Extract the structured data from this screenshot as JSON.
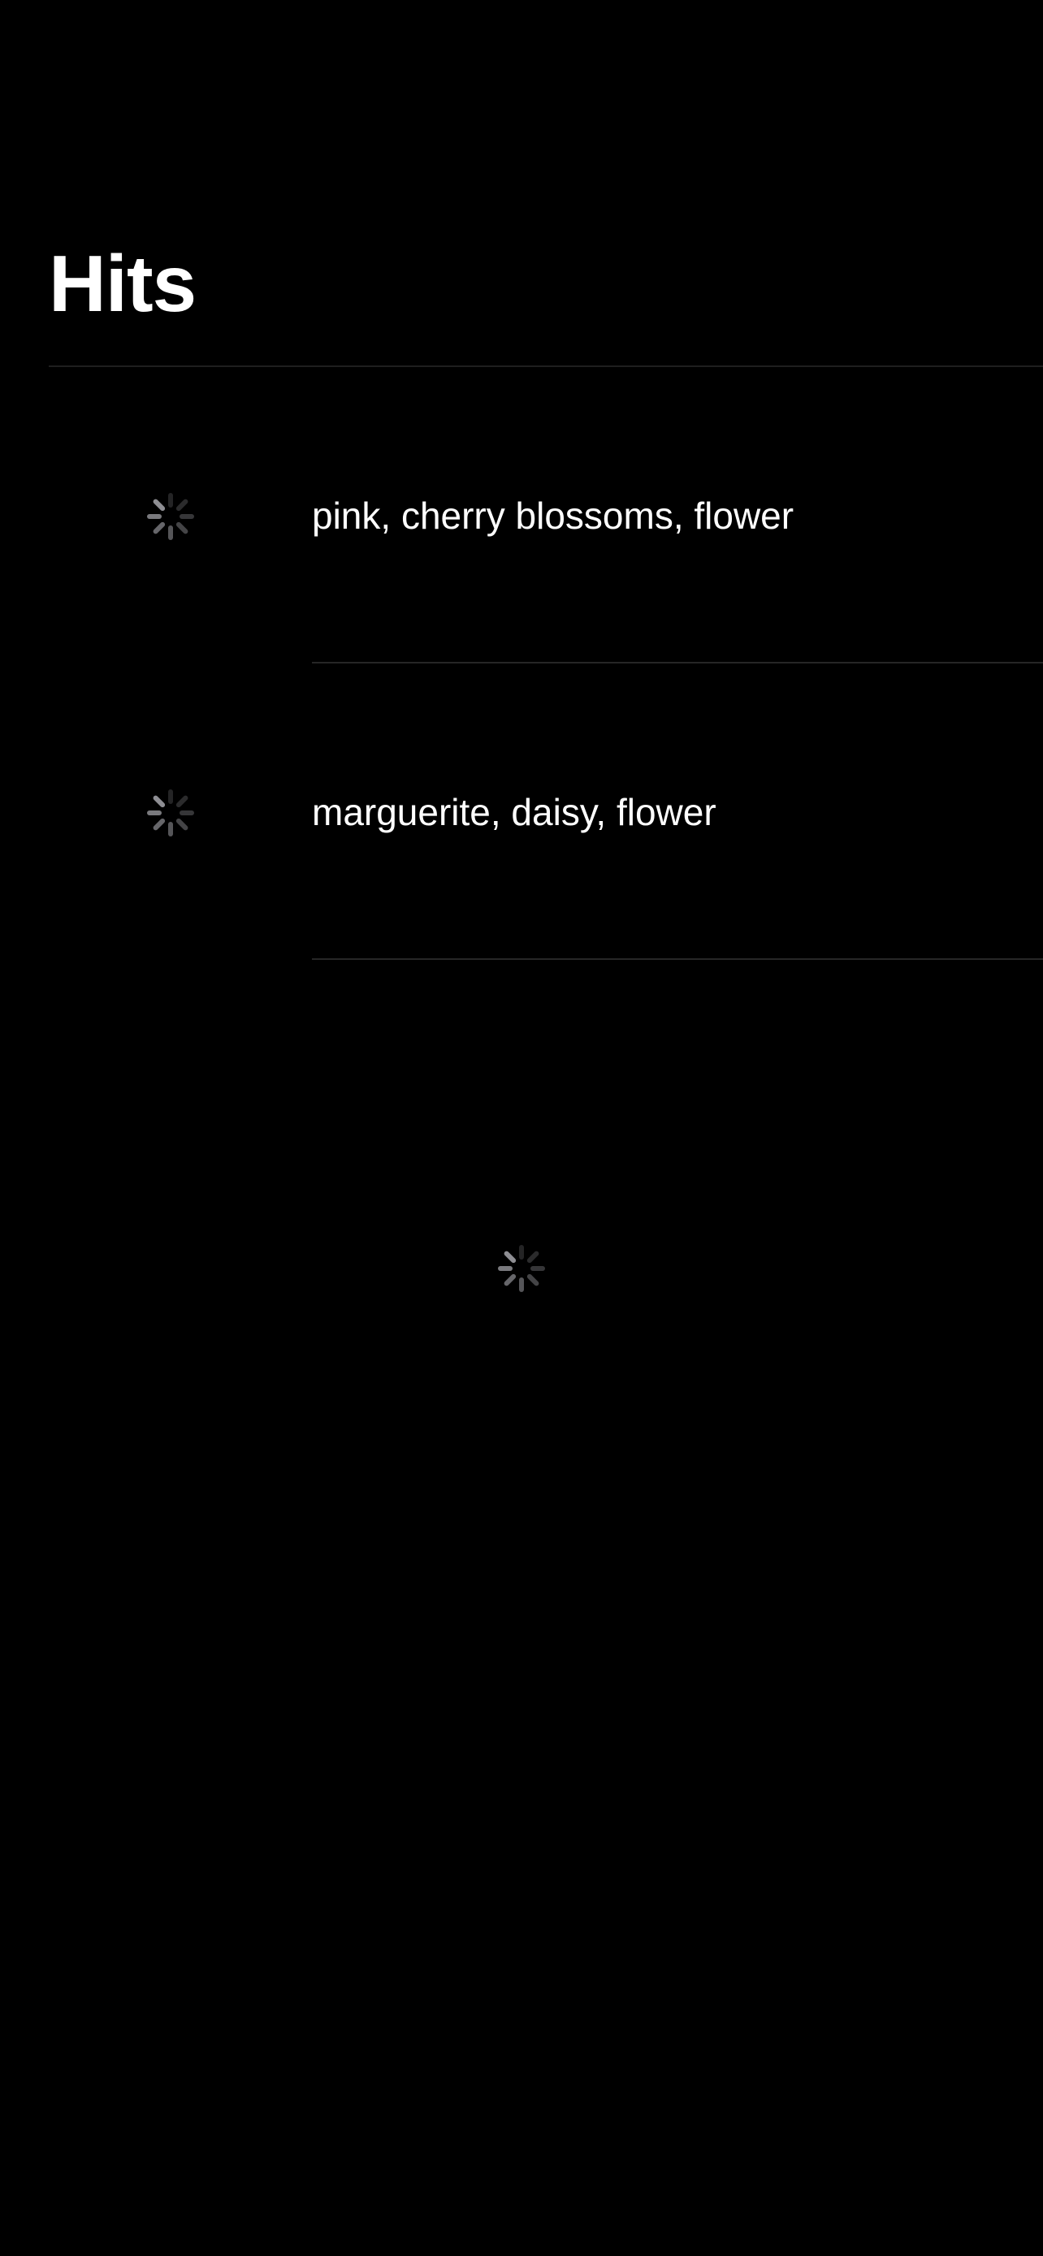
{
  "screen": {
    "title": "Hits",
    "background": "#000000"
  },
  "hits": [
    {
      "label": "pink, cherry blossoms, flower",
      "thumbnail_state": "loading",
      "icon": "activity-spinner-icon"
    },
    {
      "label": "marguerite, daisy, flower",
      "thumbnail_state": "loading",
      "icon": "activity-spinner-icon"
    }
  ],
  "footer": {
    "state": "loading",
    "icon": "activity-spinner-icon"
  },
  "colors": {
    "text": "#ffffff",
    "divider": "#262626",
    "spinner": "#8e8e93"
  }
}
